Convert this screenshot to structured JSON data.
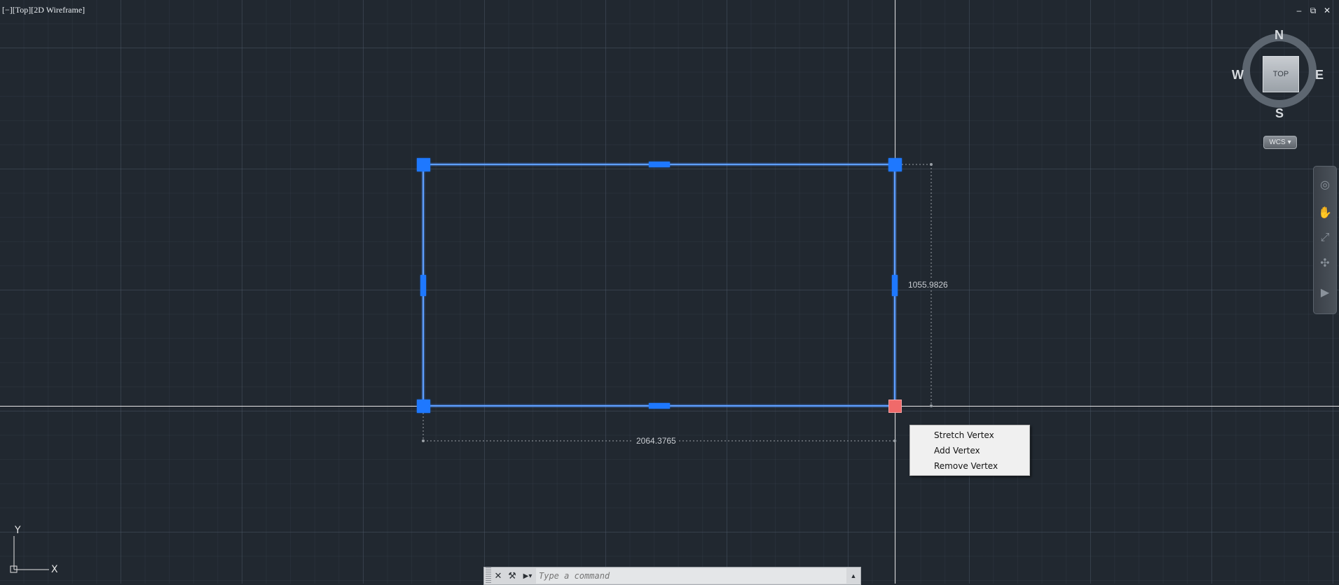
{
  "viewport": {
    "label": "[−][Top][2D Wireframe]"
  },
  "window_controls": {
    "minimize": "‒",
    "restore": "⧉",
    "close": "✕"
  },
  "dimensions": {
    "vertical": "1055.9826",
    "horizontal": "2064.3765"
  },
  "context_menu": {
    "items": [
      {
        "label": "Stretch Vertex"
      },
      {
        "label": "Add Vertex"
      },
      {
        "label": "Remove Vertex"
      }
    ]
  },
  "viewcube": {
    "north": "N",
    "south": "S",
    "east": "E",
    "west": "W",
    "face": "TOP"
  },
  "wcs": {
    "label": "WCS",
    "arrow": "▾"
  },
  "ucs": {
    "x_label": "X",
    "y_label": "Y"
  },
  "command_line": {
    "placeholder": "Type a command",
    "close_icon": "✕",
    "customize_icon": "⚒",
    "prompt_icon": "▶▾",
    "history_arrow": "▲"
  },
  "colors": {
    "background": "#212830",
    "selection": "#1e78ff",
    "hot_grip": "#f06a6a",
    "polyline": "#4a90ff"
  }
}
